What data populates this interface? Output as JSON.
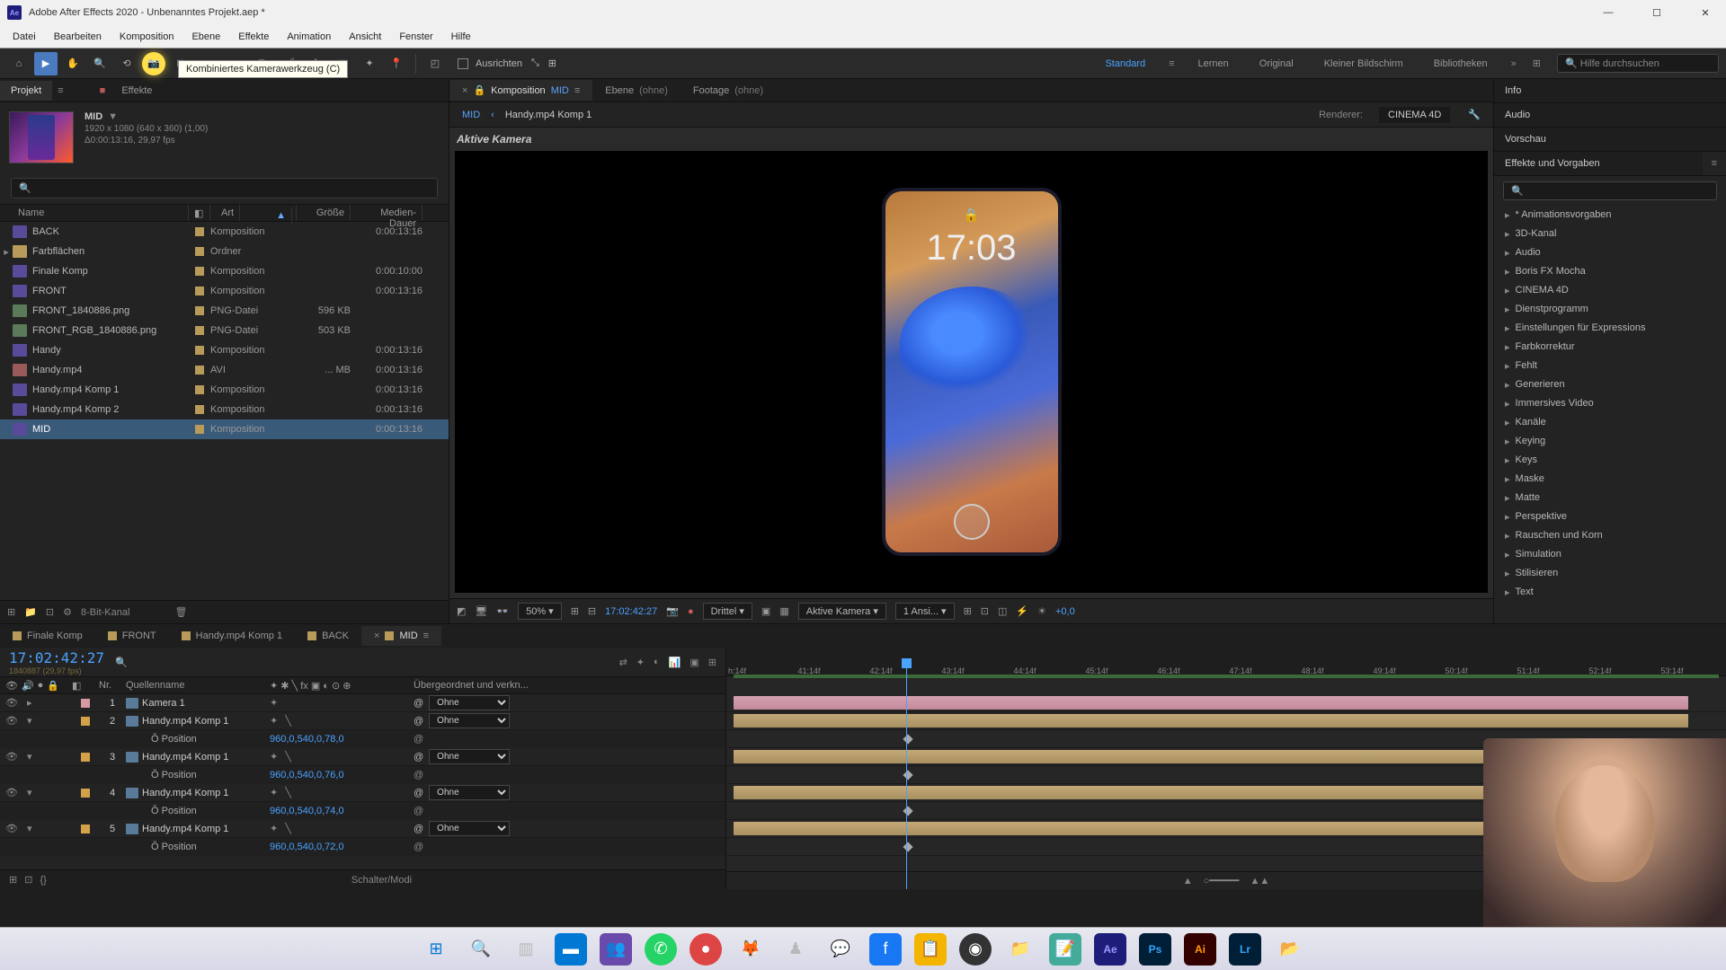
{
  "title": "Adobe After Effects 2020 - Unbenanntes Projekt.aep *",
  "menubar": [
    "Datei",
    "Bearbeiten",
    "Komposition",
    "Ebene",
    "Effekte",
    "Animation",
    "Ansicht",
    "Fenster",
    "Hilfe"
  ],
  "toolbar": {
    "align_label": "Ausrichten",
    "tooltip": "Kombiniertes Kamerawerkzeug (C)",
    "workspaces": [
      "Standard",
      "Lernen",
      "Original",
      "Kleiner Bildschirm",
      "Bibliotheken"
    ],
    "active_workspace": "Standard",
    "search_placeholder": "Hilfe durchsuchen"
  },
  "project": {
    "tab": "Projekt",
    "other_tab": "Effekte",
    "comp_name": "MID",
    "comp_res": "1920 x 1080 (640 x 360) (1,00)",
    "comp_dur": "Δ0:00:13:16, 29,97 fps",
    "columns": {
      "name": "Name",
      "type": "Art",
      "size": "Größe",
      "dur": "Medien-Dauer"
    },
    "items": [
      {
        "name": "BACK",
        "type": "Komposition",
        "size": "",
        "dur": "0:00:13:16",
        "icon": "comp"
      },
      {
        "name": "Farbflächen",
        "type": "Ordner",
        "size": "",
        "dur": "",
        "icon": "folder",
        "expandable": true
      },
      {
        "name": "Finale Komp",
        "type": "Komposition",
        "size": "",
        "dur": "0:00:10:00",
        "icon": "comp"
      },
      {
        "name": "FRONT",
        "type": "Komposition",
        "size": "",
        "dur": "0:00:13:16",
        "icon": "comp"
      },
      {
        "name": "FRONT_1840886.png",
        "type": "PNG-Datei",
        "size": "596 KB",
        "dur": "",
        "icon": "png"
      },
      {
        "name": "FRONT_RGB_1840886.png",
        "type": "PNG-Datei",
        "size": "503 KB",
        "dur": "",
        "icon": "png"
      },
      {
        "name": "Handy",
        "type": "Komposition",
        "size": "",
        "dur": "0:00:13:16",
        "icon": "comp"
      },
      {
        "name": "Handy.mp4",
        "type": "AVI",
        "size": "... MB",
        "dur": "0:00:13:16",
        "icon": "avi"
      },
      {
        "name": "Handy.mp4 Komp 1",
        "type": "Komposition",
        "size": "",
        "dur": "0:00:13:16",
        "icon": "comp"
      },
      {
        "name": "Handy.mp4 Komp 2",
        "type": "Komposition",
        "size": "",
        "dur": "0:00:13:16",
        "icon": "comp"
      },
      {
        "name": "MID",
        "type": "Komposition",
        "size": "",
        "dur": "0:00:13:16",
        "icon": "comp",
        "selected": true
      }
    ],
    "bitdepth": "8-Bit-Kanal"
  },
  "comp_panel": {
    "tabs": {
      "comp_prefix": "Komposition",
      "comp_name": "MID",
      "layer": "Ebene",
      "layer_empty": "(ohne)",
      "footage": "Footage",
      "footage_empty": "(ohne)"
    },
    "breadcrumb": {
      "current": "MID",
      "next": "Handy.mp4 Komp 1",
      "renderer_label": "Renderer:",
      "renderer": "CINEMA 4D"
    },
    "active_camera": "Aktive Kamera",
    "phone_time": "17:03",
    "footer": {
      "zoom": "50%",
      "timecode": "17:02:42:27",
      "quality": "Drittel",
      "view": "Aktive Kamera",
      "views": "1 Ansi...",
      "exposure": "+0,0"
    }
  },
  "right_panels": {
    "info": "Info",
    "audio": "Audio",
    "preview": "Vorschau",
    "effects": "Effekte und Vorgaben",
    "effects_items": [
      "* Animationsvorgaben",
      "3D-Kanal",
      "Audio",
      "Boris FX Mocha",
      "CINEMA 4D",
      "Dienstprogramm",
      "Einstellungen für Expressions",
      "Farbkorrektur",
      "Fehlt",
      "Generieren",
      "Immersives Video",
      "Kanäle",
      "Keying",
      "Keys",
      "Maske",
      "Matte",
      "Perspektive",
      "Rauschen und Korn",
      "Simulation",
      "Stilisieren",
      "Text"
    ]
  },
  "timeline": {
    "tabs": [
      "Finale Komp",
      "FRONT",
      "Handy.mp4 Komp 1",
      "BACK",
      "MID"
    ],
    "active_tab": "MID",
    "timecode": "17:02:42:27",
    "frameinfo": "1840887 (29,97 fps)",
    "columns": {
      "num": "Nr.",
      "name": "Quellenname",
      "parent": "Übergeordnet und verkn..."
    },
    "ruler_ticks": [
      "h:14f",
      "41:14f",
      "42:14f",
      "43:14f",
      "44:14f",
      "45:14f",
      "46:14f",
      "47:14f",
      "48:14f",
      "49:14f",
      "50:14f",
      "51:14f",
      "52:14f",
      "53:14f"
    ],
    "layers": [
      {
        "num": 1,
        "name": "Kamera 1",
        "cam": true,
        "parent": "Ohne"
      },
      {
        "num": 2,
        "name": "Handy.mp4 Komp 1",
        "parent": "Ohne",
        "prop": "Position",
        "val": "960,0,540,0,78,0",
        "expanded": true
      },
      {
        "num": 3,
        "name": "Handy.mp4 Komp 1",
        "parent": "Ohne",
        "prop": "Position",
        "val": "960,0,540,0,76,0",
        "expanded": true
      },
      {
        "num": 4,
        "name": "Handy.mp4 Komp 1",
        "parent": "Ohne",
        "prop": "Position",
        "val": "960,0,540,0,74,0",
        "expanded": true
      },
      {
        "num": 5,
        "name": "Handy.mp4 Komp 1",
        "parent": "Ohne",
        "prop": "Position",
        "val": "960,0,540,0,72,0",
        "expanded": true
      }
    ],
    "toggle_label": "Schalter/Modi"
  }
}
